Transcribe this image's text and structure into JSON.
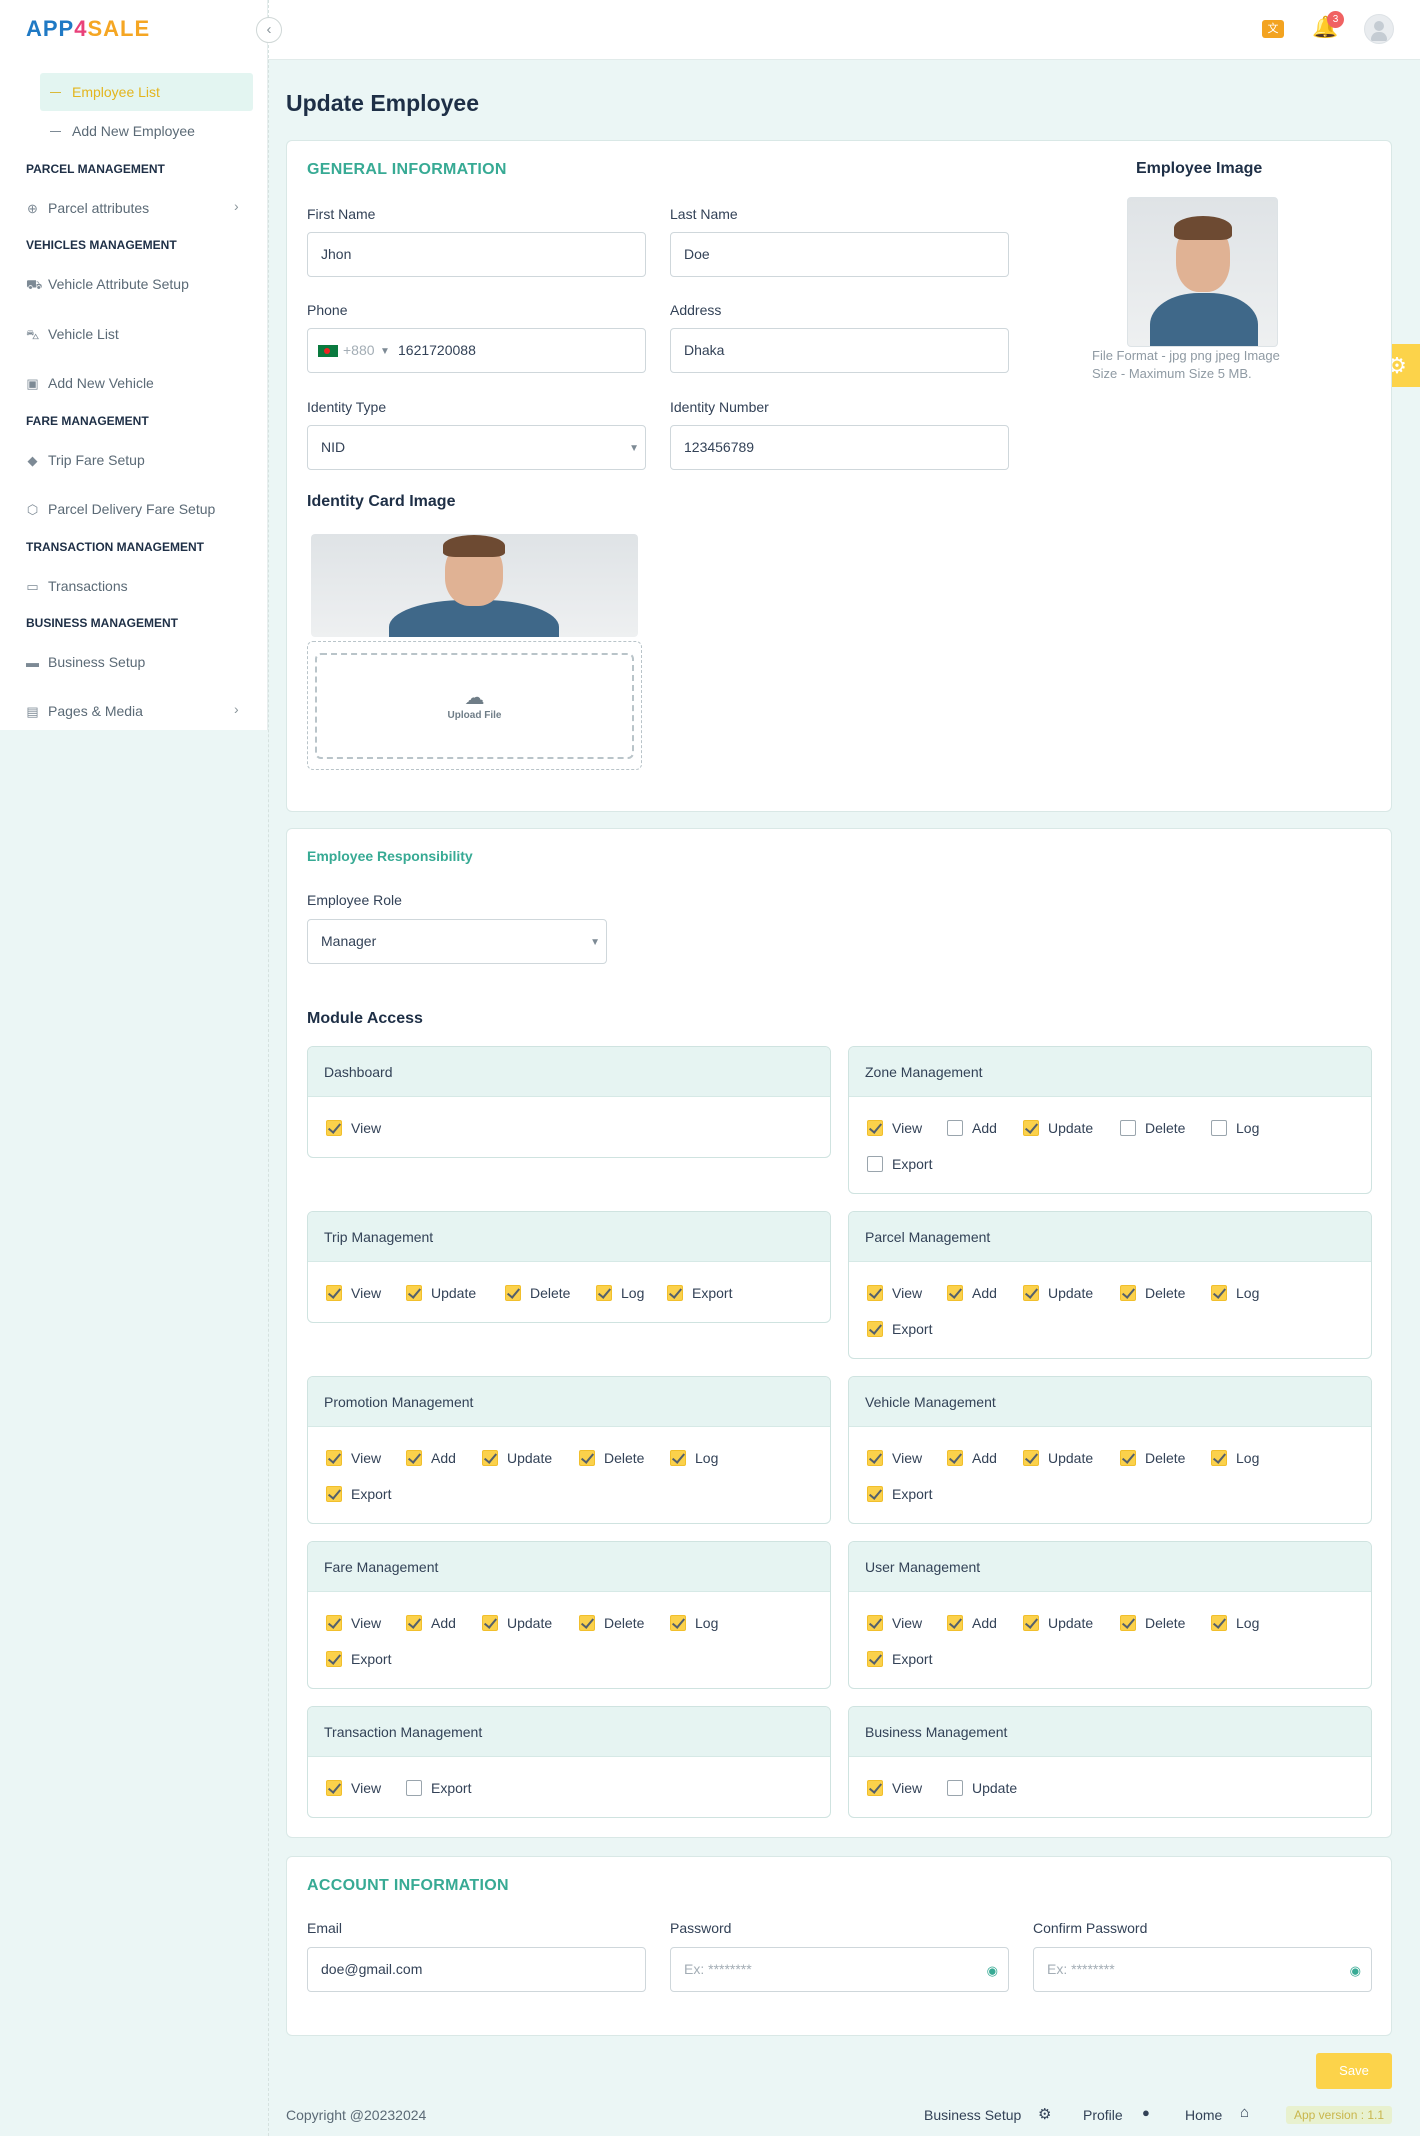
{
  "app": {
    "logo_part1": "APP",
    "logo_part2": "4",
    "logo_part3": "SALE"
  },
  "header": {
    "notification_count": "3",
    "translate_icon": "translate-icon",
    "bell_icon": "bell-icon",
    "avatar_icon": "user-avatar-icon"
  },
  "sidebar": {
    "sub_items": [
      {
        "label": "Employee List",
        "active": true
      },
      {
        "label": "Add New Employee",
        "active": false
      }
    ],
    "sections": [
      {
        "heading": "PARCEL MANAGEMENT",
        "items": [
          {
            "label": "Parcel attributes",
            "icon": "circle-plus-icon",
            "has_submenu": true
          }
        ]
      },
      {
        "heading": "VEHICLES MANAGEMENT",
        "items": [
          {
            "label": "Vehicle Attribute Setup",
            "icon": "car-front-icon"
          },
          {
            "label": "Vehicle List",
            "icon": "car-icon"
          },
          {
            "label": "Add New Vehicle",
            "icon": "bus-icon"
          }
        ]
      },
      {
        "heading": "FARE MANAGEMENT",
        "items": [
          {
            "label": "Trip Fare Setup",
            "icon": "diamond-icon"
          },
          {
            "label": "Parcel Delivery Fare Setup",
            "icon": "box-icon"
          }
        ]
      },
      {
        "heading": "TRANSACTION MANAGEMENT",
        "items": [
          {
            "label": "Transactions",
            "icon": "cash-icon"
          }
        ]
      },
      {
        "heading": "BUSINESS MANAGEMENT",
        "items": [
          {
            "label": "Business Setup",
            "icon": "briefcase-icon"
          },
          {
            "label": "Pages & Media",
            "icon": "document-icon",
            "has_submenu": true
          }
        ]
      }
    ]
  },
  "page": {
    "title": "Update Employee"
  },
  "general": {
    "title": "GENERAL INFORMATION",
    "first_name_label": "First Name",
    "first_name": "Jhon",
    "last_name_label": "Last Name",
    "last_name": "Doe",
    "phone_label": "Phone",
    "phone_code": "+880",
    "phone": "1621720088",
    "address_label": "Address",
    "address": "Dhaka",
    "identity_type_label": "Identity Type",
    "identity_type": "NID",
    "identity_number_label": "Identity Number",
    "identity_number": "123456789",
    "identity_card_image_label": "Identity Card Image",
    "upload_label": "Upload File",
    "employee_image_label": "Employee Image",
    "file_format": "File Format - jpg png jpeg Image",
    "file_size": "Size - Maximum Size 5 MB."
  },
  "responsibility": {
    "title": "Employee Responsibility",
    "role_label": "Employee Role",
    "role": "Manager",
    "module_access_label": "Module Access",
    "modules": [
      {
        "name": "Dashboard",
        "perms": [
          {
            "label": "View",
            "checked": true
          }
        ]
      },
      {
        "name": "Zone Management",
        "perms": [
          {
            "label": "View",
            "checked": true
          },
          {
            "label": "Add",
            "checked": false
          },
          {
            "label": "Update",
            "checked": true
          },
          {
            "label": "Delete",
            "checked": false
          },
          {
            "label": "Log",
            "checked": false
          },
          {
            "label": "Export",
            "checked": false
          }
        ]
      },
      {
        "name": "Trip Management",
        "perms": [
          {
            "label": "View",
            "checked": true
          },
          {
            "label": "Update",
            "checked": true
          },
          {
            "label": "Delete",
            "checked": true
          },
          {
            "label": "Log",
            "checked": true
          },
          {
            "label": "Export",
            "checked": true
          }
        ]
      },
      {
        "name": "Parcel Management",
        "perms": [
          {
            "label": "View",
            "checked": true
          },
          {
            "label": "Add",
            "checked": true
          },
          {
            "label": "Update",
            "checked": true
          },
          {
            "label": "Delete",
            "checked": true
          },
          {
            "label": "Log",
            "checked": true
          },
          {
            "label": "Export",
            "checked": true
          }
        ]
      },
      {
        "name": "Promotion Management",
        "perms": [
          {
            "label": "View",
            "checked": true
          },
          {
            "label": "Add",
            "checked": true
          },
          {
            "label": "Update",
            "checked": true
          },
          {
            "label": "Delete",
            "checked": true
          },
          {
            "label": "Log",
            "checked": true
          },
          {
            "label": "Export",
            "checked": true
          }
        ]
      },
      {
        "name": "Vehicle Management",
        "perms": [
          {
            "label": "View",
            "checked": true
          },
          {
            "label": "Add",
            "checked": true
          },
          {
            "label": "Update",
            "checked": true
          },
          {
            "label": "Delete",
            "checked": true
          },
          {
            "label": "Log",
            "checked": true
          },
          {
            "label": "Export",
            "checked": true
          }
        ]
      },
      {
        "name": "Fare Management",
        "perms": [
          {
            "label": "View",
            "checked": true
          },
          {
            "label": "Add",
            "checked": true
          },
          {
            "label": "Update",
            "checked": true
          },
          {
            "label": "Delete",
            "checked": true
          },
          {
            "label": "Log",
            "checked": true
          },
          {
            "label": "Export",
            "checked": true
          }
        ]
      },
      {
        "name": "User Management",
        "perms": [
          {
            "label": "View",
            "checked": true
          },
          {
            "label": "Add",
            "checked": true
          },
          {
            "label": "Update",
            "checked": true
          },
          {
            "label": "Delete",
            "checked": true
          },
          {
            "label": "Log",
            "checked": true
          },
          {
            "label": "Export",
            "checked": true
          }
        ]
      },
      {
        "name": "Transaction Management",
        "perms": [
          {
            "label": "View",
            "checked": true
          },
          {
            "label": "Export",
            "checked": false
          }
        ]
      },
      {
        "name": "Business Management",
        "perms": [
          {
            "label": "View",
            "checked": true
          },
          {
            "label": "Update",
            "checked": false
          }
        ]
      }
    ]
  },
  "account": {
    "title": "ACCOUNT INFORMATION",
    "email_label": "Email",
    "email": "doe@gmail.com",
    "password_label": "Password",
    "password_placeholder": "Ex: ********",
    "confirm_label": "Confirm Password",
    "confirm_placeholder": "Ex: ********"
  },
  "actions": {
    "save": "Save"
  },
  "footer": {
    "copyright": "Copyright @20232024",
    "business_setup": "Business Setup",
    "profile": "Profile",
    "home": "Home",
    "version": "App version : 1.1"
  },
  "colors": {
    "accent": "#37aa94",
    "checkbox": "#fbd14b",
    "save_button": "#fcd34a",
    "background": "#ebf6f5"
  }
}
